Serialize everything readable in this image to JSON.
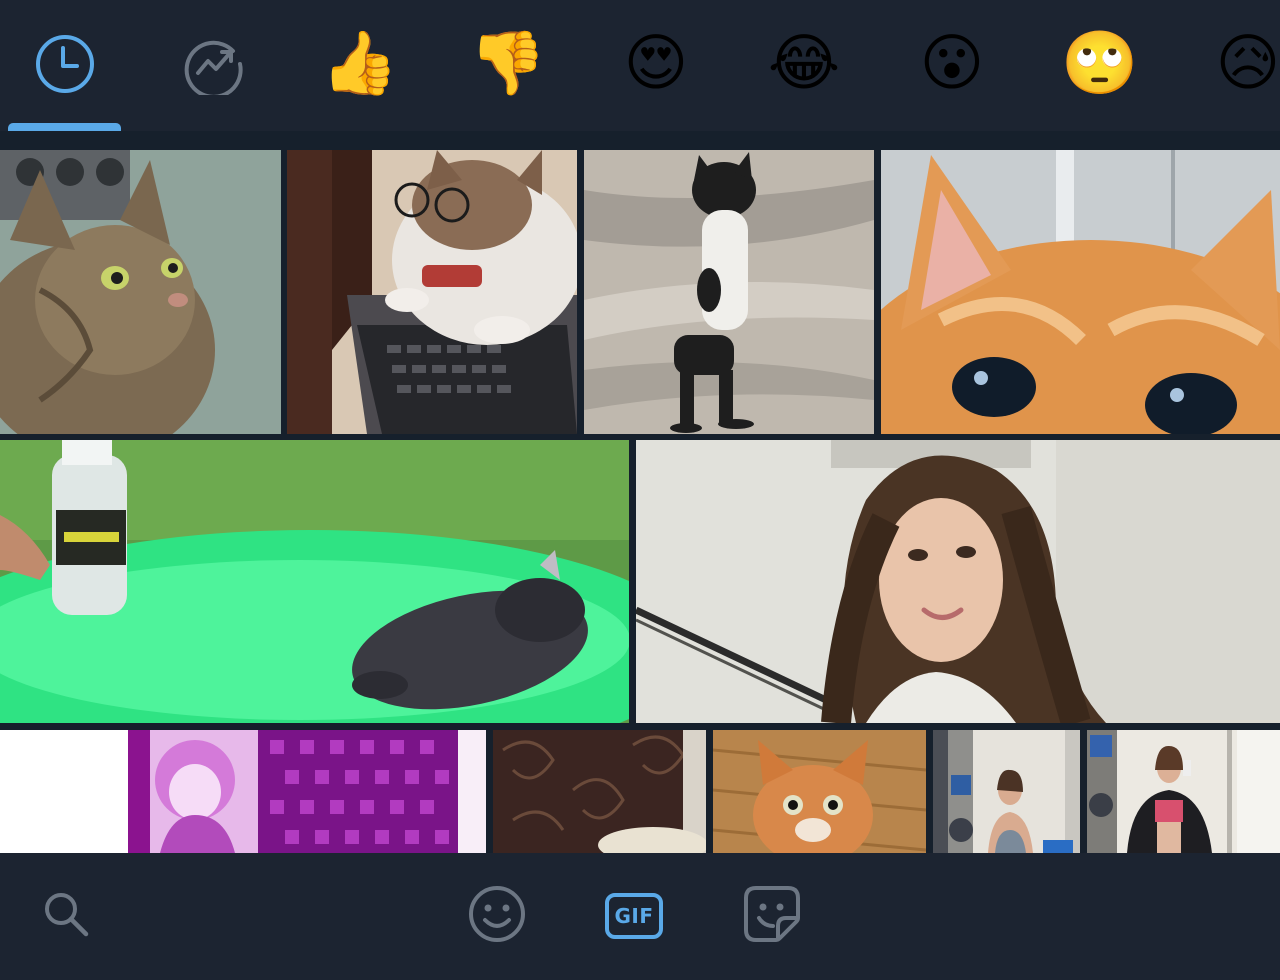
{
  "colors": {
    "background": "#1c2431",
    "accent": "#5aa9e8",
    "icon_muted": "#6c7683"
  },
  "categories": [
    {
      "id": "recent",
      "icon": "clock-icon",
      "selected": true
    },
    {
      "id": "trending",
      "icon": "trending-icon",
      "selected": false
    },
    {
      "id": "thumbs-up",
      "emoji": "👍",
      "selected": false
    },
    {
      "id": "thumbs-down",
      "emoji": "👎",
      "selected": false
    },
    {
      "id": "heart-eyes",
      "emoji": "😍",
      "selected": false
    },
    {
      "id": "tears-of-joy",
      "emoji": "😂",
      "selected": false
    },
    {
      "id": "surprised",
      "emoji": "😮",
      "selected": false
    },
    {
      "id": "eye-roll",
      "emoji": "🙄",
      "selected": false
    },
    {
      "id": "sad-sweat",
      "emoji": "😥",
      "selected": false
    }
  ],
  "gif_grid": {
    "rows": 3,
    "items": [
      {
        "subject": "tabby cat looking up"
      },
      {
        "subject": "cat with glasses at laptop"
      },
      {
        "subject": "black and white cat standing on hind legs"
      },
      {
        "subject": "orange kitten close-up eyes"
      },
      {
        "subject": "cat sliding on green table with bottle"
      },
      {
        "subject": "smiling woman with long brown hair"
      },
      {
        "subject": "purple anime girl"
      },
      {
        "subject": "brown wallpaper with cat"
      },
      {
        "subject": "orange cat staring"
      },
      {
        "subject": "woman taking mirror selfie"
      },
      {
        "subject": "woman in pink top mirror selfie"
      }
    ]
  },
  "bottom_bar": {
    "tabs": [
      {
        "id": "search",
        "icon": "search-icon",
        "selected": false
      },
      {
        "id": "emoji",
        "icon": "smiley-icon",
        "selected": false
      },
      {
        "id": "gif",
        "label": "GIF",
        "icon": "gif-icon",
        "selected": true
      },
      {
        "id": "stickers",
        "icon": "sticker-icon",
        "selected": false
      }
    ]
  }
}
